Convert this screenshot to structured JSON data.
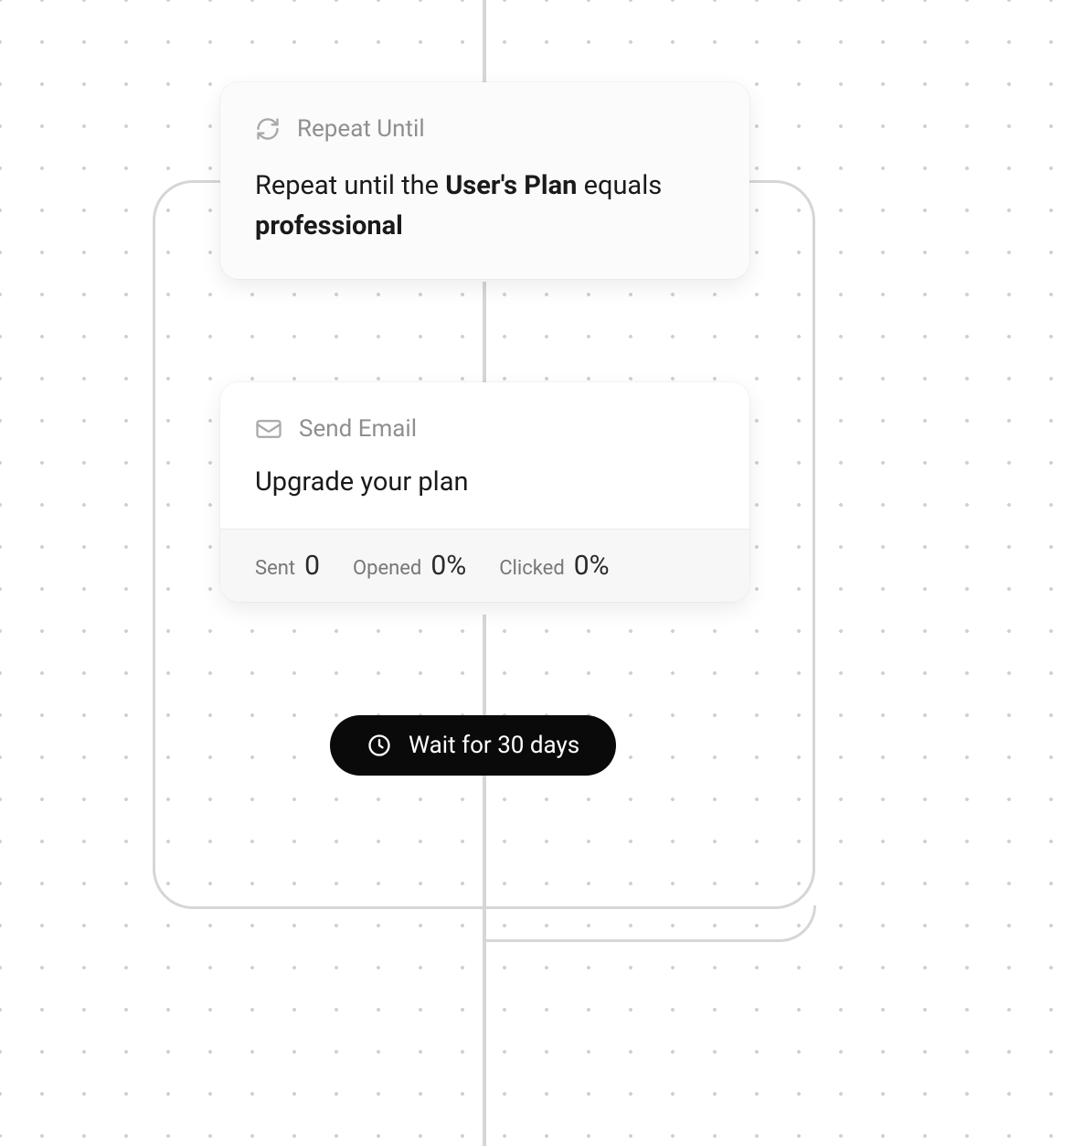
{
  "repeat": {
    "header_label": "Repeat Until",
    "prefix": "Repeat until the ",
    "field": "User's Plan",
    "mid": " equals ",
    "value": "professional"
  },
  "email": {
    "header_label": "Send Email",
    "subject": "Upgrade your plan",
    "stats": {
      "sent_label": "Sent",
      "sent_value": "0",
      "opened_label": "Opened",
      "opened_value": "0%",
      "clicked_label": "Clicked",
      "clicked_value": "0%"
    }
  },
  "wait": {
    "label": "Wait for 30 days"
  }
}
